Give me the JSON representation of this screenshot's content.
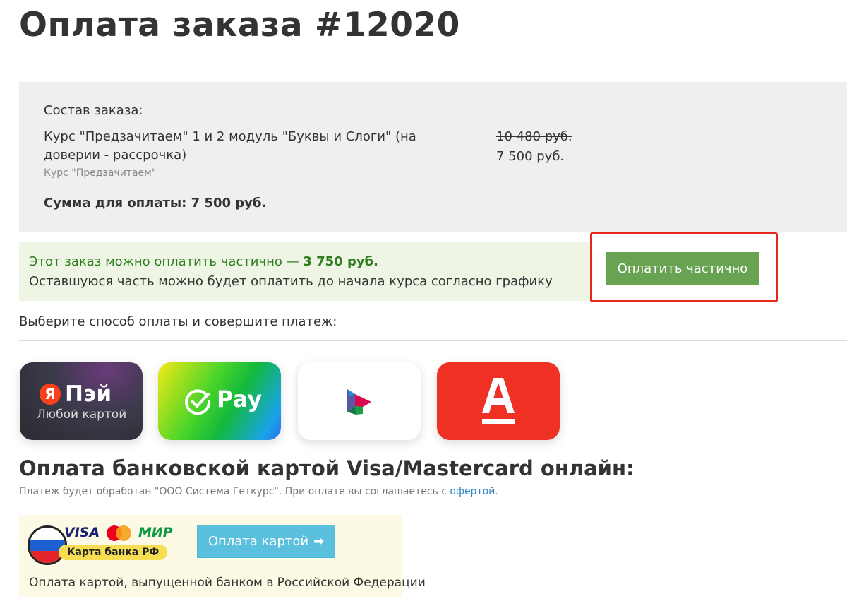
{
  "page": {
    "title": "Оплата заказа #12020"
  },
  "order": {
    "heading": "Состав заказа:",
    "item": {
      "name": "Курс \"Предзачитаем\" 1 и 2 модуль \"Буквы и Слоги\" (на доверии - рассрочка)",
      "course": "Курс \"Предзачитаем\"",
      "price_old": "10 480 руб.",
      "price_new": "7 500 руб."
    },
    "total": "Сумма для оплаты: 7 500 руб."
  },
  "partial": {
    "text_prefix": "Этот заказ можно оплатить частично — ",
    "amount": "3 750 руб.",
    "note": "Оставшуюся часть можно будет оплатить до начала курса согласно графику",
    "button_label": "Оплатить частично",
    "highlight_color": "#e8251c",
    "button_color": "#67a351"
  },
  "payment_methods": {
    "prompt": "Выберите способ оплаты и совершите платеж:",
    "items": [
      {
        "id": "yandex-pay",
        "logo_letter": "Я",
        "logo_text": "Пэй",
        "sub": "Любой картой",
        "icon": "yandex-pay-icon"
      },
      {
        "id": "sber-pay",
        "logo_text": "Pay",
        "icon": "sberpay-checkmark-icon"
      },
      {
        "id": "sbp",
        "icon": "sbp-icon"
      },
      {
        "id": "alfa",
        "icon": "alfa-bank-icon"
      }
    ]
  },
  "card_payment": {
    "title": "Оплата банковской картой Visa/Mastercard онлайн:",
    "note_prefix": "Платеж будет обработан \"ООО Система Геткурс\". При оплате вы соглашаетесь с ",
    "offer_link": "офертой",
    "note_suffix": ".",
    "brand_visa": "VISA",
    "brand_mir": "МИР",
    "bank_badge": "Карта банка РФ",
    "button_label": "Оплата картой",
    "caption": "Оплата картой, выпущенной банком в Российской Федерации",
    "button_color": "#5bc0de"
  }
}
